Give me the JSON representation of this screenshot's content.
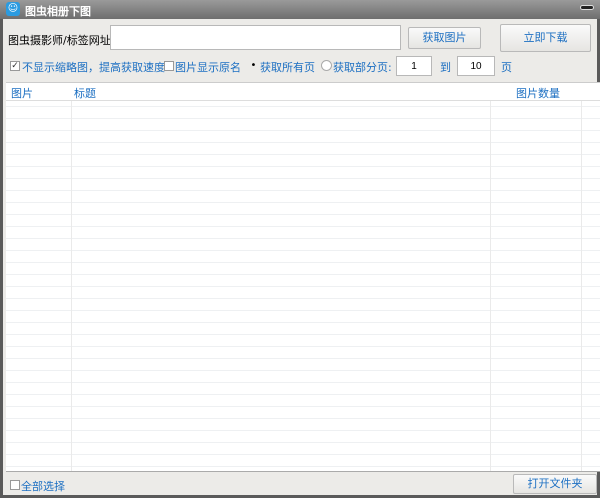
{
  "window": {
    "title": "图虫相册下图"
  },
  "form": {
    "url_label": "图虫摄影师/标签网址:",
    "url_value": "",
    "fetch_button": "获取图片",
    "download_button": "立即下载",
    "no_thumbnail_label": "不显示缩略图，提高获取速度",
    "no_thumbnail_checked": true,
    "original_name_label": "图片显示原名",
    "original_name_checked": false,
    "all_pages_label": "获取所有页",
    "partial_pages_label": "获取部分页:",
    "page_mode": "all",
    "page_from": "1",
    "to_label": "到",
    "page_to": "10",
    "page_unit": "页"
  },
  "table": {
    "columns": [
      "图片",
      "标题",
      "图片数量"
    ],
    "rows": []
  },
  "footer": {
    "select_all_label": "全部选择",
    "select_all_checked": false,
    "open_folder_button": "打开文件夹"
  }
}
